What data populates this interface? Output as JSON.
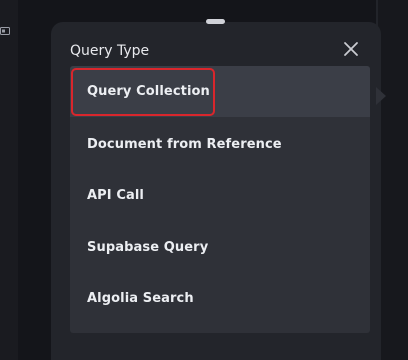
{
  "dialog": {
    "title": "Query Type",
    "close_icon": "close-icon"
  },
  "menu": {
    "selected_index": 0,
    "items": [
      {
        "label": "Query Collection"
      },
      {
        "label": "Document from Reference"
      },
      {
        "label": "API Call"
      },
      {
        "label": "Supabase Query"
      },
      {
        "label": "Algolia Search"
      }
    ]
  },
  "colors": {
    "background": "#14151a",
    "sheet": "#23252b",
    "menu": "#2f3138",
    "selected_row": "#3b3e47",
    "highlight": "#d9262c",
    "text": "#eceef2"
  }
}
